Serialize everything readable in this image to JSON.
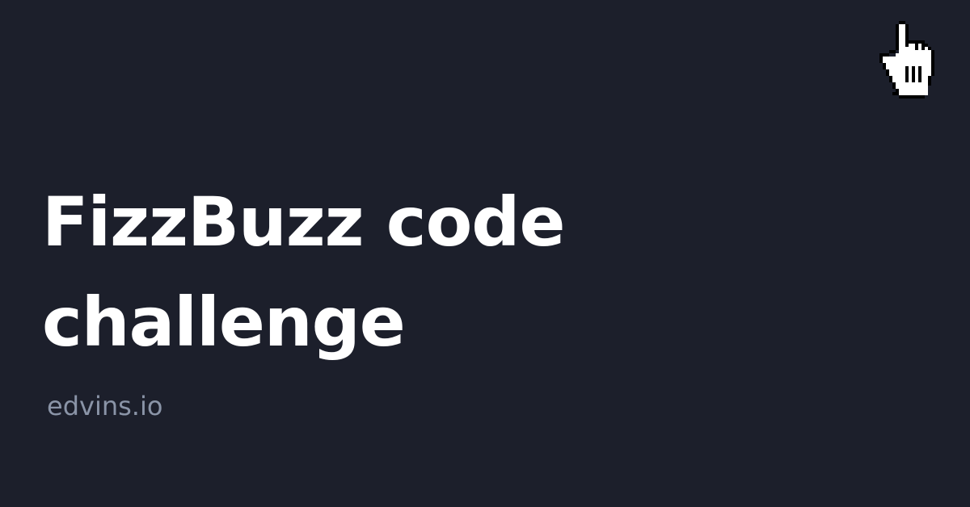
{
  "card": {
    "title_line_1": "FizzBuzz code",
    "title_line_2": "challenge",
    "site": "edvins.io"
  },
  "colors": {
    "background": "#1c1f2b",
    "title": "#ffffff",
    "site": "#8a94a7"
  },
  "icons": {
    "cursor": "hand-pointer-icon"
  }
}
